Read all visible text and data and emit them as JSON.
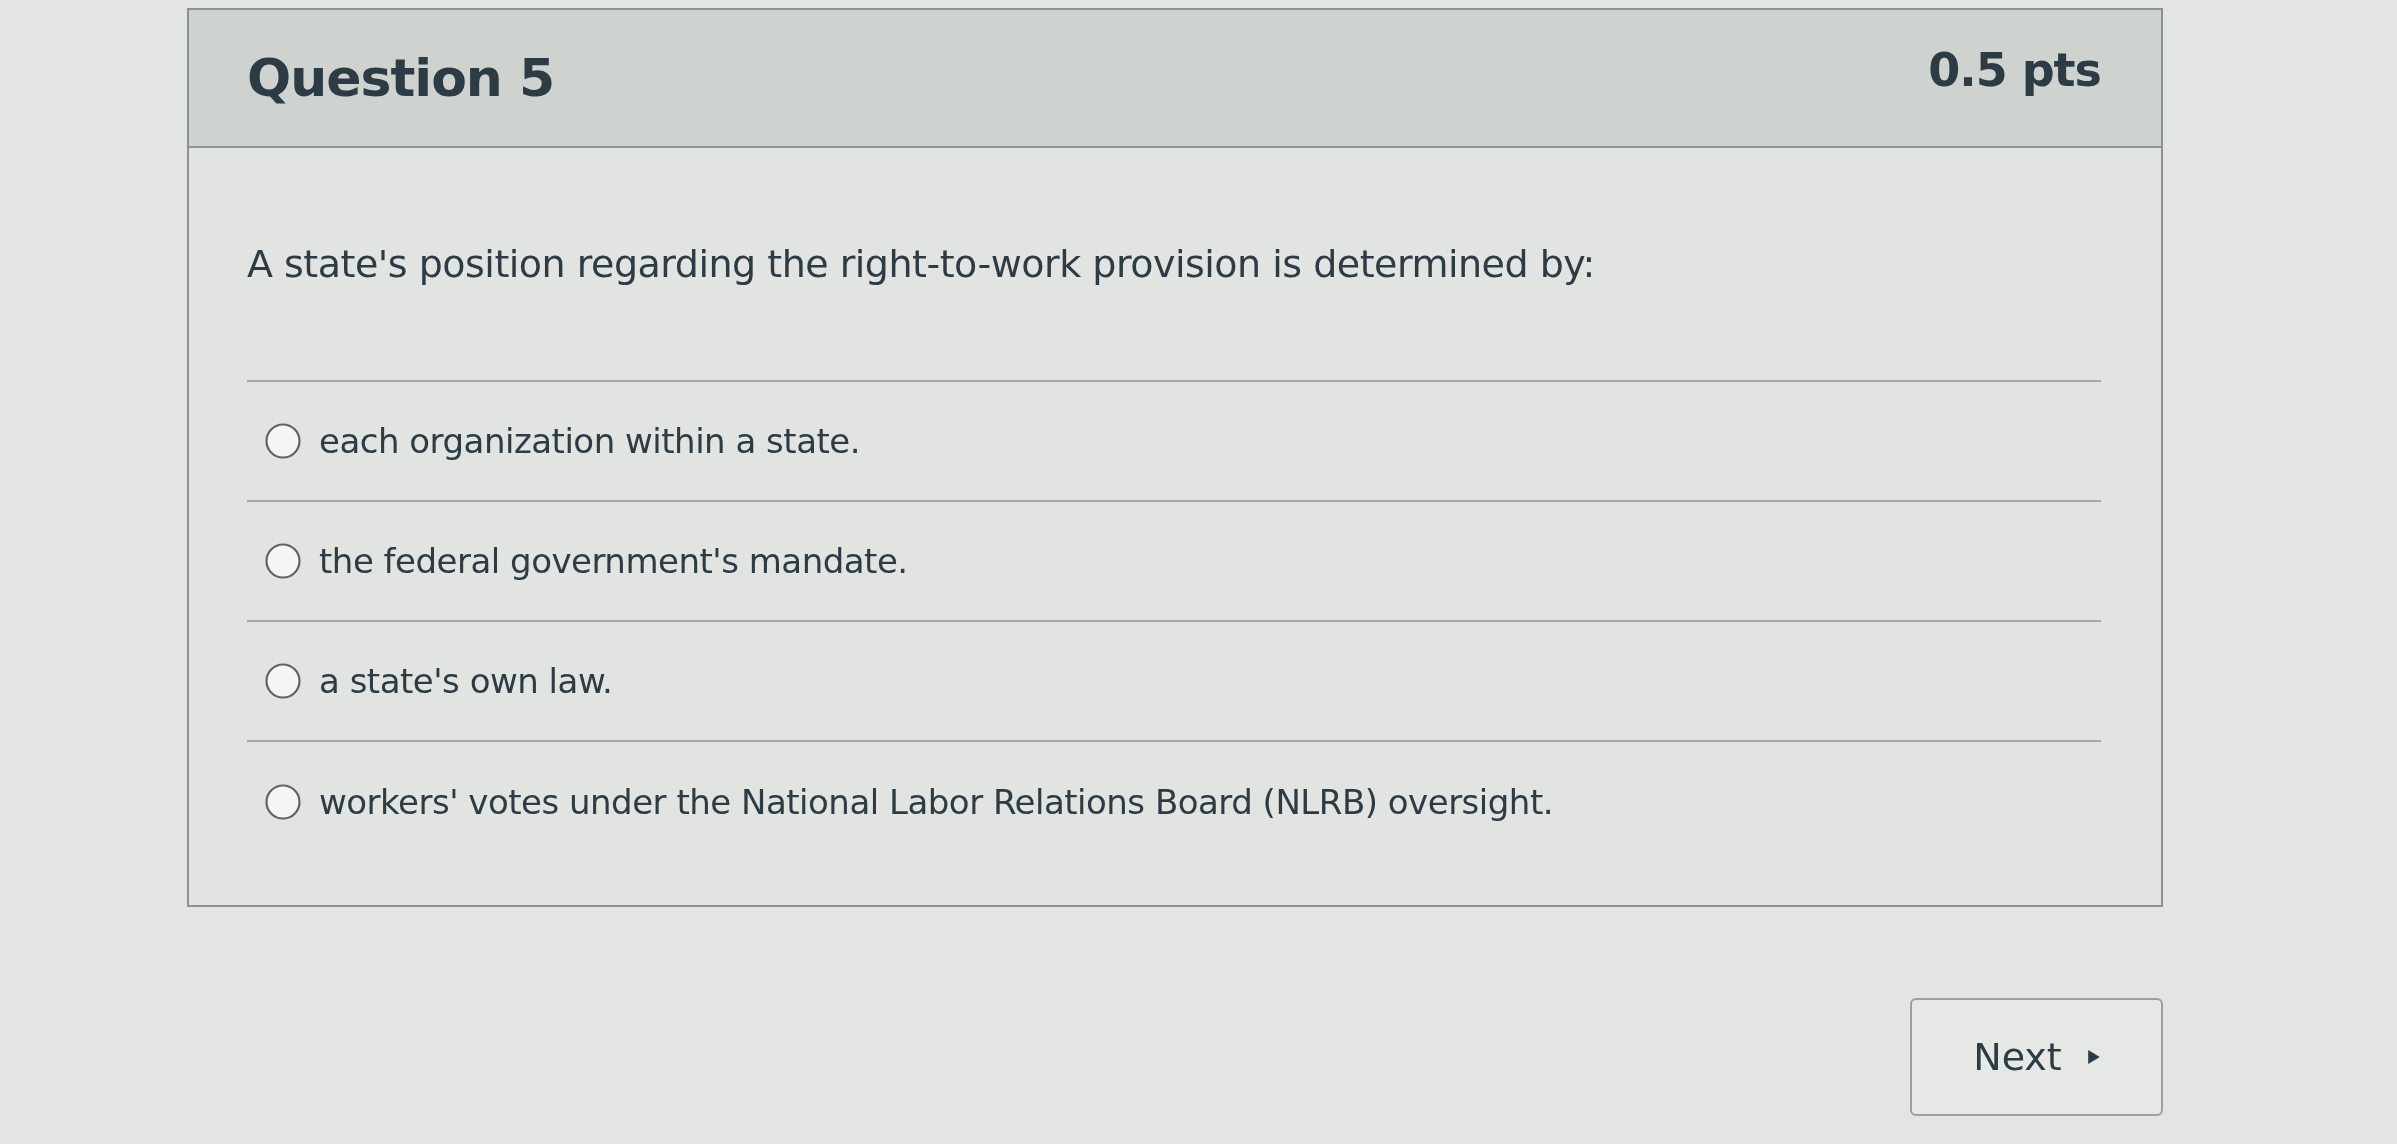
{
  "question": {
    "title": "Question 5",
    "points": "0.5 pts",
    "text": "A state's position regarding the right-to-work provision is determined by:",
    "answers": [
      {
        "label": "each organization within a state.",
        "selected": false
      },
      {
        "label": "the federal government's mandate.",
        "selected": false
      },
      {
        "label": "a state's own law.",
        "selected": false
      },
      {
        "label": "workers' votes under the National Labor Relations Board (NLRB) oversight.",
        "selected": false
      }
    ]
  },
  "navigation": {
    "next_button": "Next"
  }
}
